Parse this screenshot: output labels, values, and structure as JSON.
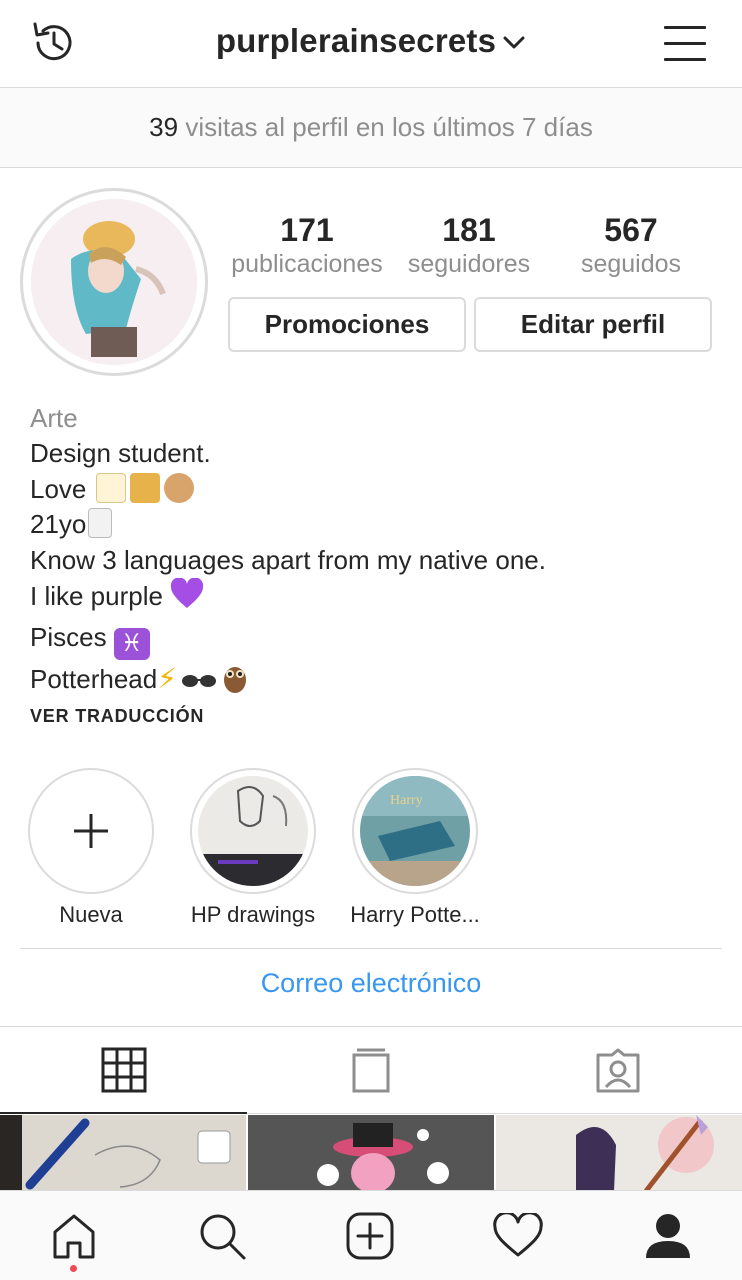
{
  "header": {
    "username": "purplerainsecrets",
    "icons": {
      "history": "history-icon",
      "dropdown": "chevron-down-icon",
      "menu": "hamburger-menu-icon"
    }
  },
  "visits": {
    "count": "39",
    "text": " visitas al perfil en los últimos 7 días"
  },
  "profile": {
    "stats": [
      {
        "value": "171",
        "label": "publicaciones"
      },
      {
        "value": "181",
        "label": "seguidores"
      },
      {
        "value": "567",
        "label": "seguidos"
      }
    ],
    "buttons": {
      "promotions": "Promociones",
      "edit": "Editar perfil"
    }
  },
  "bio": {
    "category": "Arte",
    "lines": [
      "Design student.",
      "Love ",
      "21yo",
      "Know 3 languages apart from my native one.",
      "I like purple ",
      "Pisces ",
      "Potterhead"
    ],
    "translate": "VER TRADUCCIÓN"
  },
  "highlights": [
    {
      "name": "Nueva"
    },
    {
      "name": "HP drawings"
    },
    {
      "name": "Harry Potte..."
    }
  ],
  "contact": {
    "email_label": "Correo electrónico"
  },
  "tabs": [
    "grid-icon",
    "igtv-icon",
    "tagged-icon"
  ],
  "bottom_nav": [
    "home-icon",
    "search-icon",
    "add-post-icon",
    "heart-icon",
    "profile-icon"
  ],
  "colors": {
    "link": "#3897f0",
    "notification": "#ed4956",
    "border": "#dbdbdb",
    "muted": "#8e8e8e",
    "text": "#262626"
  }
}
